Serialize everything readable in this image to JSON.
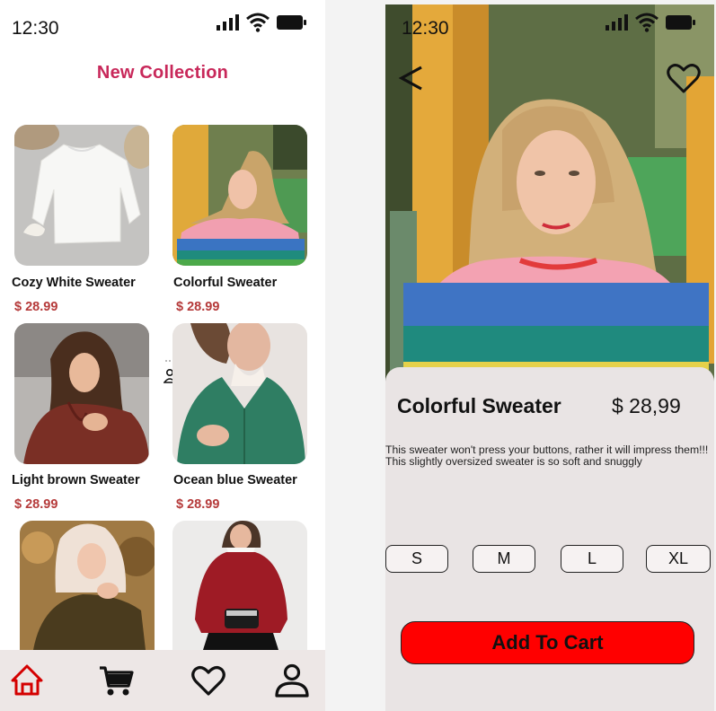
{
  "left_screen": {
    "status": {
      "time": "12:30"
    },
    "title": "New Collection",
    "products": [
      {
        "name": "Cozy White Sweater",
        "price": "$ 28.99"
      },
      {
        "name": "Colorful Sweater",
        "price": "$ 28.99"
      },
      {
        "name": "Light brown Sweater",
        "price": "$ 28.99"
      },
      {
        "name": "Ocean blue Sweater",
        "price": "$ 28.99"
      },
      {
        "name": "",
        "price": ""
      },
      {
        "name": "",
        "price": ""
      }
    ],
    "nav": [
      "home-icon",
      "cart-icon",
      "heart-icon",
      "profile-icon"
    ]
  },
  "right_screen": {
    "status": {
      "time": "12:30"
    },
    "product": {
      "name": "Colorful Sweater",
      "price": "$ 28,99",
      "description": "This sweater won't press your buttons, rather it will impress them!!! This slightly oversized sweater is so soft and snuggly"
    },
    "sizes": [
      "S",
      "M",
      "L",
      "XL"
    ],
    "add_to_cart_label": "Add To Cart"
  },
  "colors": {
    "title": "#c8285a",
    "price": "#b53a3a",
    "accent_red": "#ff0000",
    "nav_active": "#d40000",
    "panel_bg": "#e9e4e4"
  }
}
